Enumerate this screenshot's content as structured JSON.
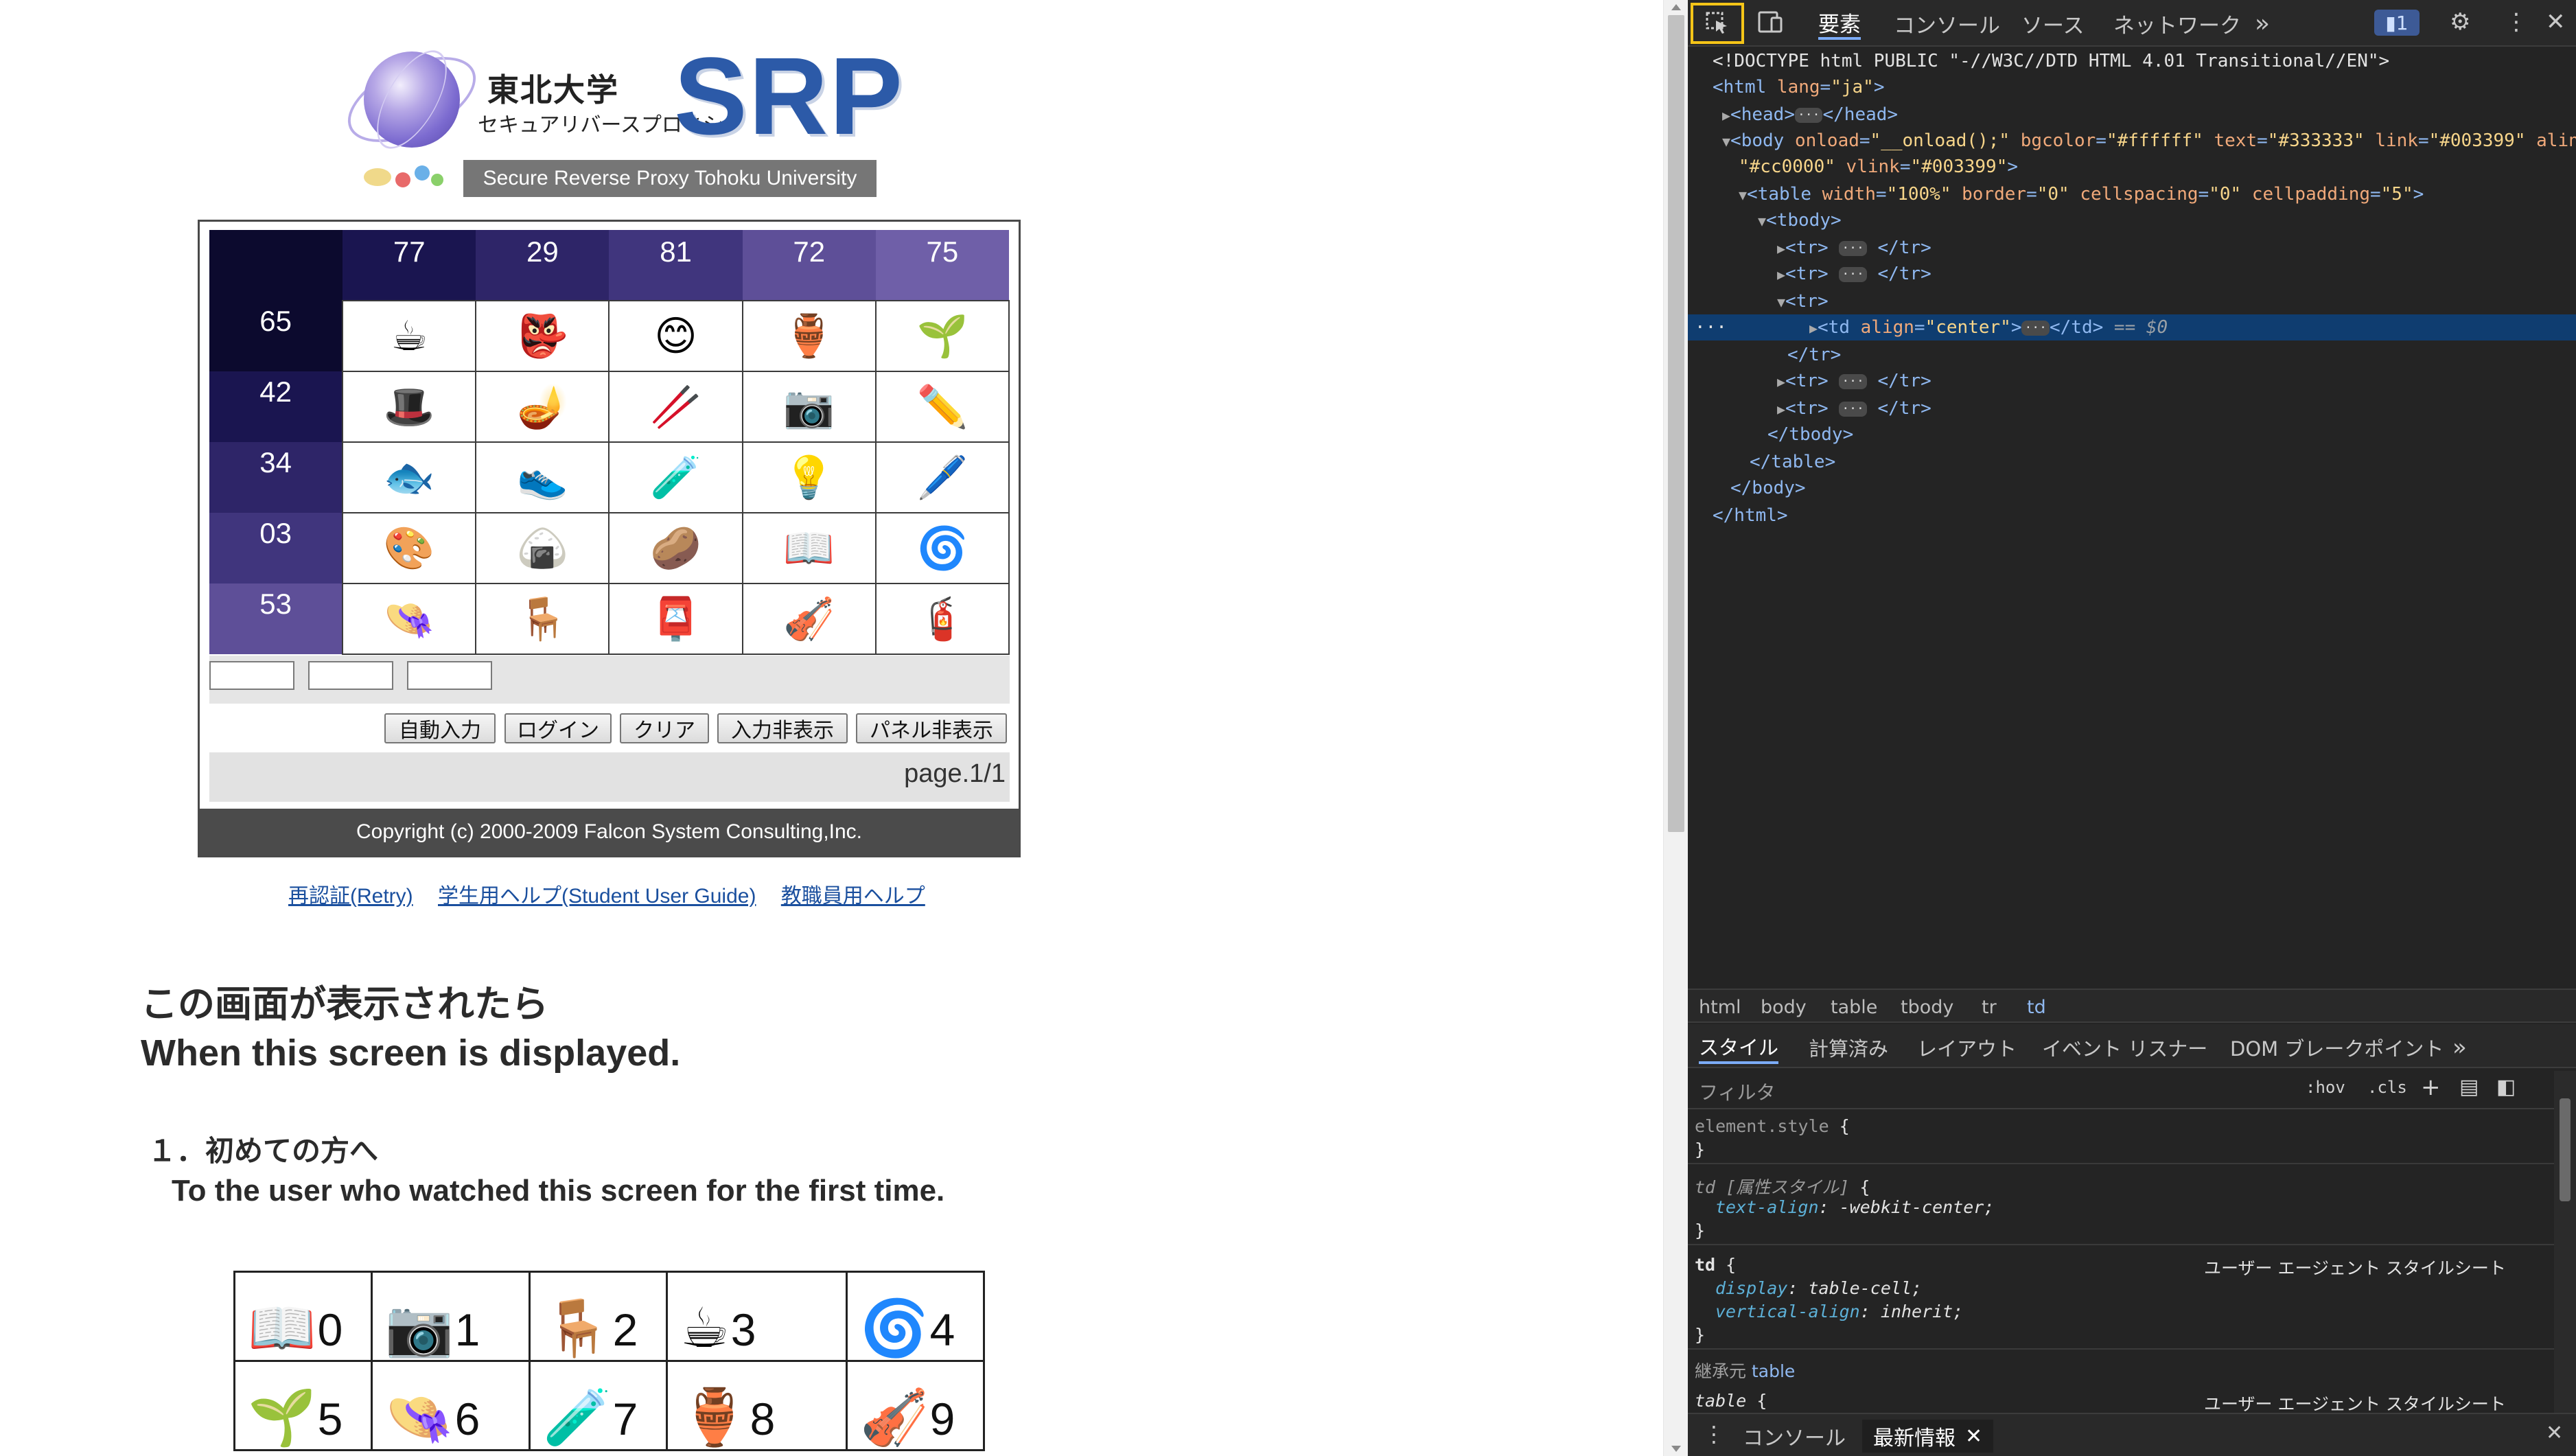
{
  "logo": {
    "jp_name": "東北大学",
    "jp_sub": "セキュアリバースプロキシ",
    "brand": "SRP",
    "subtitle": "Secure Reverse Proxy  Tohoku University"
  },
  "matrix": {
    "col_headers": [
      "77",
      "29",
      "81",
      "72",
      "75"
    ],
    "rows": [
      {
        "label": "65",
        "cells": [
          "teacup-icon",
          "red-mask-icon",
          "okame-mask-icon",
          "jars-icon",
          "sprout-icon"
        ]
      },
      {
        "label": "42",
        "cells": [
          "hat-icon",
          "magic-lamp-icon",
          "chopsticks-icon",
          "camera-icon",
          "pencil-icon"
        ]
      },
      {
        "label": "34",
        "cells": [
          "fishbowl-icon",
          "sneakers-icon",
          "paint-tube-icon",
          "lamp-icon",
          "pen-icon"
        ]
      },
      {
        "label": "03",
        "cells": [
          "palette-icon",
          "rice-ball-icon",
          "potato-doll-icon",
          "book-icon",
          "fan-icon"
        ]
      },
      {
        "label": "53",
        "cells": [
          "straw-hat-icon",
          "chair-icon",
          "postbox-icon",
          "violin-icon",
          "fire-extinguisher-icon"
        ]
      }
    ],
    "cell_glyphs": {
      "teacup-icon": "☕",
      "red-mask-icon": "👺",
      "okame-mask-icon": "😊",
      "jars-icon": "🏺",
      "sprout-icon": "🌱",
      "hat-icon": "🎩",
      "magic-lamp-icon": "🪔",
      "chopsticks-icon": "🥢",
      "camera-icon": "📷",
      "pencil-icon": "✏️",
      "fishbowl-icon": "🐟",
      "sneakers-icon": "👟",
      "paint-tube-icon": "🧪",
      "lamp-icon": "💡",
      "pen-icon": "🖊️",
      "palette-icon": "🎨",
      "rice-ball-icon": "🍙",
      "potato-doll-icon": "🥔",
      "book-icon": "📖",
      "fan-icon": "🌀",
      "straw-hat-icon": "👒",
      "chair-icon": "🪑",
      "postbox-icon": "📮",
      "violin-icon": "🎻",
      "fire-extinguisher-icon": "🧯"
    },
    "header_colors": [
      "#0c0a2e",
      "#1a1550",
      "#2e2568",
      "#40357d",
      "#5e4f98",
      "#6f5fa8"
    ]
  },
  "controls": {
    "buttons": [
      "自動入力",
      "ログイン",
      "クリア",
      "入力非表示",
      "パネル非表示"
    ],
    "page_indicator": "page.1/1",
    "copyright": "Copyright (c) 2000-2009 Falcon System Consulting,Inc."
  },
  "links": [
    "再認証(Retry)",
    "学生用ヘルプ(Student User Guide)",
    "教職員用ヘルプ"
  ],
  "content": {
    "heading_jp": "この画面が表示されたら",
    "heading_en": "When this screen is displayed.",
    "section1_jp": "１．初めての方へ",
    "section1_en": "To the user who watched this screen for the first time."
  },
  "legend": {
    "items": [
      {
        "icon": "📖",
        "name": "book-icon",
        "num": "0"
      },
      {
        "icon": "📷",
        "name": "camera-icon",
        "num": "1"
      },
      {
        "icon": "🪑",
        "name": "chair-icon",
        "num": "2"
      },
      {
        "icon": "☕",
        "name": "teacup-icon",
        "num": "3"
      },
      {
        "icon": "🌀",
        "name": "fan-icon",
        "num": "4"
      },
      {
        "icon": "🌱",
        "name": "sprout-icon",
        "num": "5"
      },
      {
        "icon": "👒",
        "name": "straw-hat-icon",
        "num": "6"
      },
      {
        "icon": "🧪",
        "name": "paint-tube-icon",
        "num": "7"
      },
      {
        "icon": "🏺",
        "name": "jars-icon",
        "num": "8"
      },
      {
        "icon": "🎻",
        "name": "violin-icon",
        "num": "9"
      }
    ]
  },
  "devtools": {
    "tabs": [
      "要素",
      "コンソール",
      "ソース",
      "ネットワーク"
    ],
    "more": "»",
    "issues_badge": "1",
    "breadcrumb": [
      "html",
      "body",
      "table",
      "tbody",
      "tr",
      "td"
    ],
    "style_tabs": [
      "スタイル",
      "計算済み",
      "レイアウト",
      "イベント リスナー",
      "DOM ブレークポイント"
    ],
    "filter_placeholder": "フィルタ",
    "hov": ":hov",
    "cls": ".cls",
    "drawer_tabs": [
      "コンソール",
      "最新情報"
    ],
    "ua_label": "ユーザー エージェント スタイルシート",
    "inherited_label": "継承元",
    "inherited_from": "table"
  }
}
